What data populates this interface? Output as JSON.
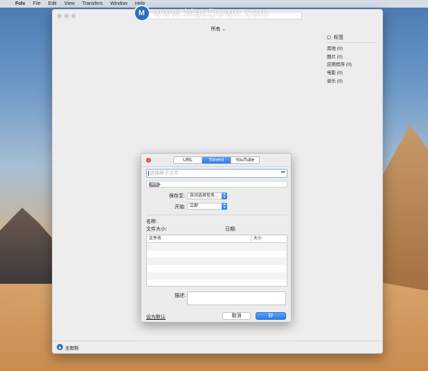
{
  "menubar": {
    "app_name": "Folx",
    "items": [
      "File",
      "Edit",
      "View",
      "Transfers",
      "Window",
      "Help"
    ]
  },
  "main": {
    "filter_label": "所有",
    "tags_header": "标签",
    "tags": [
      "其他 (0)",
      "图片 (0)",
      "应用程序 (0)",
      "电影 (0)",
      "音乐 (0)"
    ],
    "status_label": "无限制"
  },
  "sheet": {
    "tabs": [
      "URL",
      "Torrent",
      "YouTube"
    ],
    "active_tab": "Torrent",
    "torrent_placeholder": "选择种子文件",
    "browse_label": "•••",
    "tag_pill": "标签",
    "save_to_label": "保存至:",
    "save_to_value": "自动选择任务...",
    "start_label": "开始:",
    "start_value": "立即",
    "name_label": "名称:",
    "file_size_label": "文件大小:",
    "date_label": "日期:",
    "table": {
      "columns": [
        "文件名",
        "大小"
      ]
    },
    "description_label": "描述:",
    "set_default_label": "设为默认",
    "cancel_label": "取消",
    "ok_label": "好"
  },
  "watermark": {
    "text": "www.MacDown.com",
    "logo_letter": "M"
  }
}
